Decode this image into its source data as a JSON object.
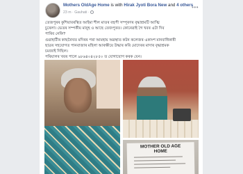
{
  "post": {
    "author": "Mothers OldAge Home",
    "with_text": "is with",
    "tagged_person": "Hirak Jyoti Bora New",
    "and_text": "and",
    "others": "4 others",
    "time": "23 m",
    "location": "Gauhati",
    "more_icon": "more-icon",
    "body": [
      "তেজপুৰৰ কুশিয়াবৰস্থিত আইমা শীল মাতৰ বহুপী সম্পূৰণৰ বৃদ্ধাশ্ৰমটি আত্মি",
      "চুৰেলা। ভেতৰ সম্পৰ্কীয় মানুহ ও আছে তেজপুৰত। কোনেৱাই গৈ খবৰ এটা দিব",
      "পাৰিব নেকি?",
      "গুৱাহাটীৰ কাছৰৈখত মদিৰৰ পৰা আমহায় অৱস্থাত কটন কলেজৰ একাংশ মানবাধিকাৰী",
      "ছাত্ৰৰ সহযোগত পানবাজাৰ মহিলা আৰক্ষীয়ে উদ্ধাৰ কৰি মোদেৰৰ মাদাৰ বৃদ্ধাশ্ৰমক",
      "চমজাই দিছিল।",
      "পৰিয়ালৰ খবৰ পালে ৯৮৬৪০৪২৮৫০ ত যোগাযোগ কৰক যেন।"
    ]
  },
  "photos": {
    "document_title_line1": "MOTHER OLD AGE",
    "document_title_line2": "HOME"
  }
}
